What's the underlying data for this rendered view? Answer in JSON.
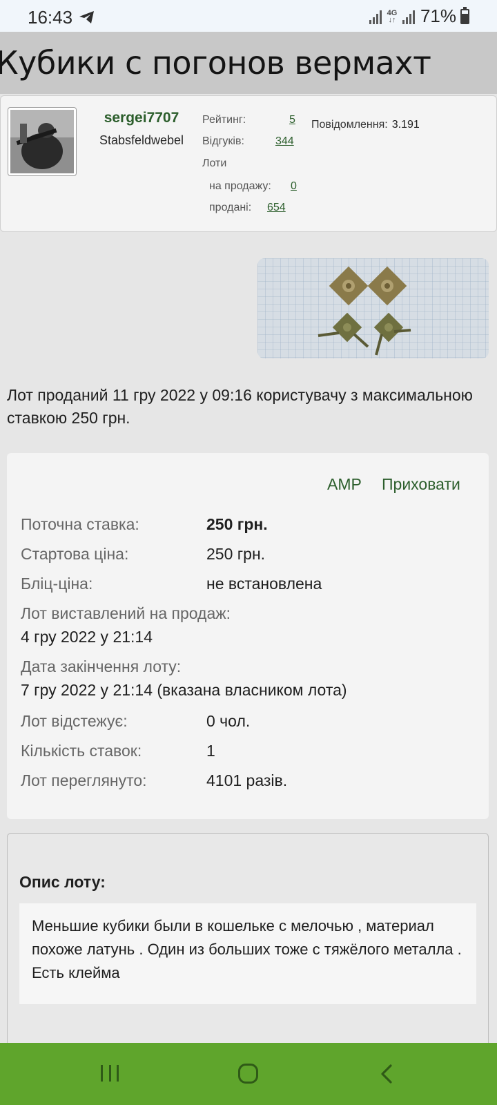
{
  "status_bar": {
    "time": "16:43",
    "network": "4G",
    "battery": "71%",
    "icons": [
      "telegram-icon",
      "signal-icon",
      "network-4g-icon",
      "signal-icon",
      "battery-icon"
    ]
  },
  "page": {
    "title": "Кубики с погонов вермахт"
  },
  "seller": {
    "username": "sergei7707",
    "rank": "Stabsfeldwebel",
    "rating_label": "Рейтинг:",
    "rating_value": "5",
    "reviews_label": "Відгуків:",
    "reviews_value": "344",
    "lots_label": "Лоти",
    "for_sale_label": "на продажу:",
    "for_sale_value": "0",
    "sold_label": "продані:",
    "sold_value": "654",
    "messages_label": "Повідомлення:",
    "messages_value": "3.191"
  },
  "lot": {
    "sold_notice": "Лот проданий 11 гру 2022 у 09:16 користувачу з максимальною ставкою 250 грн.",
    "actions": {
      "amp": "AMP",
      "hide": "Приховати"
    },
    "details": {
      "current_bid_label": "Поточна ставка:",
      "current_bid_value": "250 грн.",
      "start_price_label": "Стартова ціна:",
      "start_price_value": "250 грн.",
      "blitz_label": "Бліц-ціна:",
      "blitz_value": "не встановлена",
      "listed_label": "Лот виставлений на продаж:",
      "listed_value": "4 гру 2022 у 21:14",
      "end_label": "Дата закінчення лоту:",
      "end_value": "7 гру 2022 у 21:14 (вказана власником лота)",
      "watching_label": "Лот відстежує:",
      "watching_value": "0 чол.",
      "bids_label": "Кількість ставок:",
      "bids_value": "1",
      "views_label": "Лот переглянуто:",
      "views_value": "4101 разів."
    },
    "description_heading": "Опис лоту:",
    "description_text": "Меньшие кубики были в кошельке с мелочью , материал похоже латунь . Один из больших тоже с тяжёлого металла . Есть клейма"
  },
  "colors": {
    "link_green": "#2c5e2c",
    "nav_bar": "#5fa52c"
  }
}
